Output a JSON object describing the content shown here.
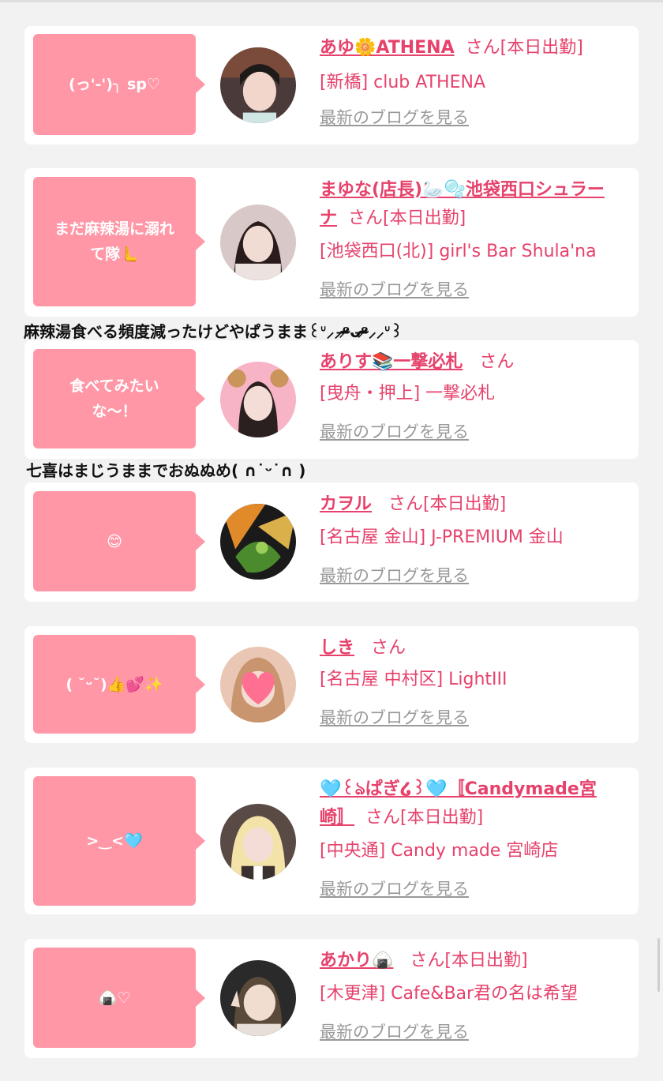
{
  "cards": [
    {
      "bubble": "(っ'-')╮ sp♡",
      "name": "あゆ🌼ATHENA",
      "san": "さん[本日出勤]",
      "shop": "[新橋] club ATHENA",
      "blog": "最新のブログを見る",
      "avatar_colors": [
        "#4a3a3a",
        "#f2d6cc",
        "#1f1a1a"
      ]
    },
    {
      "bubble": "まだ麻辣湯に溺れ\nて隊🫷",
      "name": "まゆな(店長)🦢🫧池袋西口シュラーナ",
      "san": "さん[本日出勤]",
      "shop": "[池袋西口(北)] girl's Bar Shula'na",
      "blog": "最新のブログを見る",
      "avatar_colors": [
        "#d8c8c8",
        "#f1dcd4",
        "#2a1c1c"
      ]
    },
    {
      "bubble": "食べてみたい\nな〜！",
      "name": "ありす📚一撃必札",
      "san": "さん",
      "shop": "[曳舟・押上] 一撃必札",
      "blog": "最新のブログを見る",
      "avatar_colors": [
        "#f6b4c6",
        "#f4ddd6",
        "#2b2020"
      ]
    },
    {
      "bubble": "😊",
      "name": "カヲル",
      "san": "さん[本日出勤]",
      "shop": "[名古屋 金山] J-PREMIUM 金山",
      "blog": "最新のブログを見る",
      "avatar_colors": [
        "#e08a2a",
        "#4c8a2e",
        "#1a1a1a"
      ]
    },
    {
      "bubble": "( ˘ᵕ˘)👍💕✨",
      "name": "しき",
      "san": "さん",
      "shop": "[名古屋 中村区] LightIII",
      "blog": "最新のブログを見る",
      "avatar_colors": [
        "#e9c7b4",
        "#ff6f91",
        "#c9956f"
      ]
    },
    {
      "bubble": ">‿<🩵",
      "name": "🩵꒰ঌぱぎ໒꒱🩵〚Candymade宮崎〛",
      "san": "さん[本日出勤]",
      "shop": "[中央通] Candy made 宮崎店",
      "blog": "最新のブログを見る",
      "avatar_colors": [
        "#f3e3a8",
        "#f4ddd6",
        "#3a3030"
      ]
    },
    {
      "bubble": "🍙♡",
      "name": "あかり🍙",
      "san": "さん[本日出勤]",
      "shop": "[木更津] Cafe&Bar君の名は希望",
      "blog": "最新のブログを見る",
      "avatar_colors": [
        "#2a2a2a",
        "#f1dcd0",
        "#5a4a3a"
      ]
    }
  ],
  "overlays": [
    "麻辣湯食べる頻度減ったけどやぱうまま꒰ᐡ⸝⸝ᵒ̴̶̷ᴗᵒ̴̶̷⸝⸝ᐡ꒱",
    "七喜はまじうままでおぬぬめ( ∩˙ᵕ˙∩ )"
  ],
  "colors": {
    "accent": "#e6426b",
    "bubble": "#ff97a7",
    "background": "#f2f2f2",
    "link_gray": "#999999"
  }
}
